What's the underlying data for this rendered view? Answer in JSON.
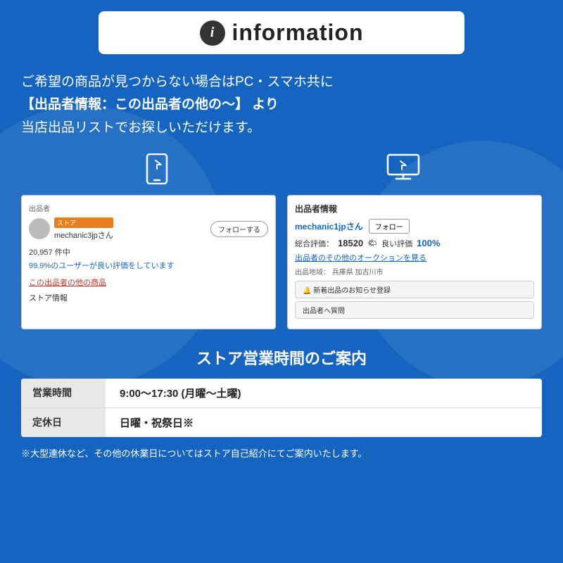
{
  "header": {
    "title": "information"
  },
  "main_text": {
    "line1": "ご希望の商品が見つからない場合はPC・スマホ共に",
    "line2": "【出品者情報：この出品者の他の〜】 より",
    "line3": "当店出品リストでお探しいただけます。"
  },
  "left_card": {
    "seller_section_label": "出品者",
    "store_badge": "ストア",
    "seller_name": "mechanic3jpさん",
    "follow_button": "フォローする",
    "stats": "20,957 件中",
    "good_rating_text": "99.9%のユーザーが良い評価をしています",
    "other_items_link": "この出品者の他の商品",
    "store_info": "ストア情報"
  },
  "right_card": {
    "section_title": "出品者情報",
    "seller_name": "mechanic1jpさん",
    "follow_button": "フォロー",
    "total_rating_label": "総合評価：",
    "total_rating_score": "18520",
    "good_rating_label": "良い評価",
    "good_rating_pct": "100%",
    "auction_link": "出品者のその他のオークションを見る",
    "location_label": "出品地域：",
    "location_value": "兵庫県 加古川市",
    "new_items_btn": "🔔 新着出品のお知らせ登録",
    "question_btn": "出品者へ質問"
  },
  "store_hours": {
    "title": "ストア営業時間のご案内",
    "rows": [
      {
        "label": "営業時間",
        "value": "9:00〜17:30 (月曜〜土曜)"
      },
      {
        "label": "定休日",
        "value": "日曜・祝祭日※"
      }
    ]
  },
  "footnote": "※大型連休など、その他の休業日についてはストア自己紹介にてご案内いたします。"
}
